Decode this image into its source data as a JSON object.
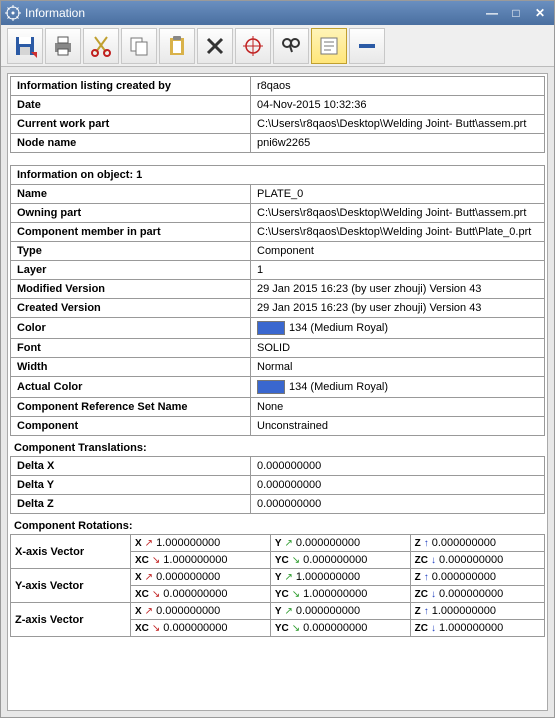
{
  "window": {
    "title": "Information"
  },
  "header_table": {
    "rows": [
      {
        "label": "Information listing created by",
        "value": "r8qaos"
      },
      {
        "label": "Date",
        "value": "04-Nov-2015 10:32:36"
      },
      {
        "label": "Current work part",
        "value": "C:\\Users\\r8qaos\\Desktop\\Welding Joint- Butt\\assem.prt"
      },
      {
        "label": "Node name",
        "value": "pni6w2265"
      }
    ]
  },
  "object_section": {
    "heading": "Information on object: 1",
    "rows": [
      {
        "label": "Name",
        "value": "PLATE_0"
      },
      {
        "label": "Owning part",
        "value": "C:\\Users\\r8qaos\\Desktop\\Welding Joint- Butt\\assem.prt"
      },
      {
        "label": "Component member in part",
        "value": "C:\\Users\\r8qaos\\Desktop\\Welding Joint- Butt\\Plate_0.prt"
      },
      {
        "label": "Type",
        "value": "Component"
      },
      {
        "label": "Layer",
        "value": "1"
      },
      {
        "label": "Modified Version",
        "value": "29 Jan 2015 16:23 (by user zhouji) Version 43"
      },
      {
        "label": "Created Version",
        "value": "29 Jan 2015 16:23 (by user zhouji) Version 43"
      },
      {
        "label": "Color",
        "value": "134 (Medium Royal)",
        "swatch": "#3a67cf"
      },
      {
        "label": "Font",
        "value": "SOLID"
      },
      {
        "label": "Width",
        "value": "Normal"
      },
      {
        "label": "Actual Color",
        "value": "134 (Medium Royal)",
        "swatch": "#3a67cf"
      },
      {
        "label": "Component Reference Set Name",
        "value": "None"
      },
      {
        "label": "Component",
        "value": "Unconstrained"
      }
    ]
  },
  "translations": {
    "heading": "Component Translations:",
    "rows": [
      {
        "label": "Delta X",
        "value": "0.000000000"
      },
      {
        "label": "Delta Y",
        "value": "0.000000000"
      },
      {
        "label": "Delta Z",
        "value": "0.000000000"
      }
    ]
  },
  "rotations": {
    "heading": "Component Rotations:",
    "axes": [
      {
        "label": "X-axis Vector",
        "row1": [
          {
            "axis": "X",
            "arrow": "↗",
            "color": "#c02020",
            "v": "1.000000000"
          },
          {
            "axis": "Y",
            "arrow": "↗",
            "color": "#2a9a2a",
            "v": "0.000000000"
          },
          {
            "axis": "Z",
            "arrow": "↑",
            "color": "#2040c0",
            "v": "0.000000000"
          }
        ],
        "row2": [
          {
            "axis": "XC",
            "arrow": "↘",
            "color": "#c02020",
            "v": "1.000000000"
          },
          {
            "axis": "YC",
            "arrow": "↘",
            "color": "#2a9a2a",
            "v": "0.000000000"
          },
          {
            "axis": "ZC",
            "arrow": "↓",
            "color": "#2040c0",
            "v": "0.000000000"
          }
        ]
      },
      {
        "label": "Y-axis Vector",
        "row1": [
          {
            "axis": "X",
            "arrow": "↗",
            "color": "#c02020",
            "v": "0.000000000"
          },
          {
            "axis": "Y",
            "arrow": "↗",
            "color": "#2a9a2a",
            "v": "1.000000000"
          },
          {
            "axis": "Z",
            "arrow": "↑",
            "color": "#2040c0",
            "v": "0.000000000"
          }
        ],
        "row2": [
          {
            "axis": "XC",
            "arrow": "↘",
            "color": "#c02020",
            "v": "0.000000000"
          },
          {
            "axis": "YC",
            "arrow": "↘",
            "color": "#2a9a2a",
            "v": "1.000000000"
          },
          {
            "axis": "ZC",
            "arrow": "↓",
            "color": "#2040c0",
            "v": "0.000000000"
          }
        ]
      },
      {
        "label": "Z-axis Vector",
        "row1": [
          {
            "axis": "X",
            "arrow": "↗",
            "color": "#c02020",
            "v": "0.000000000"
          },
          {
            "axis": "Y",
            "arrow": "↗",
            "color": "#2a9a2a",
            "v": "0.000000000"
          },
          {
            "axis": "Z",
            "arrow": "↑",
            "color": "#2040c0",
            "v": "1.000000000"
          }
        ],
        "row2": [
          {
            "axis": "XC",
            "arrow": "↘",
            "color": "#c02020",
            "v": "0.000000000"
          },
          {
            "axis": "YC",
            "arrow": "↘",
            "color": "#2a9a2a",
            "v": "0.000000000"
          },
          {
            "axis": "ZC",
            "arrow": "↓",
            "color": "#2040c0",
            "v": "1.000000000"
          }
        ]
      }
    ]
  }
}
